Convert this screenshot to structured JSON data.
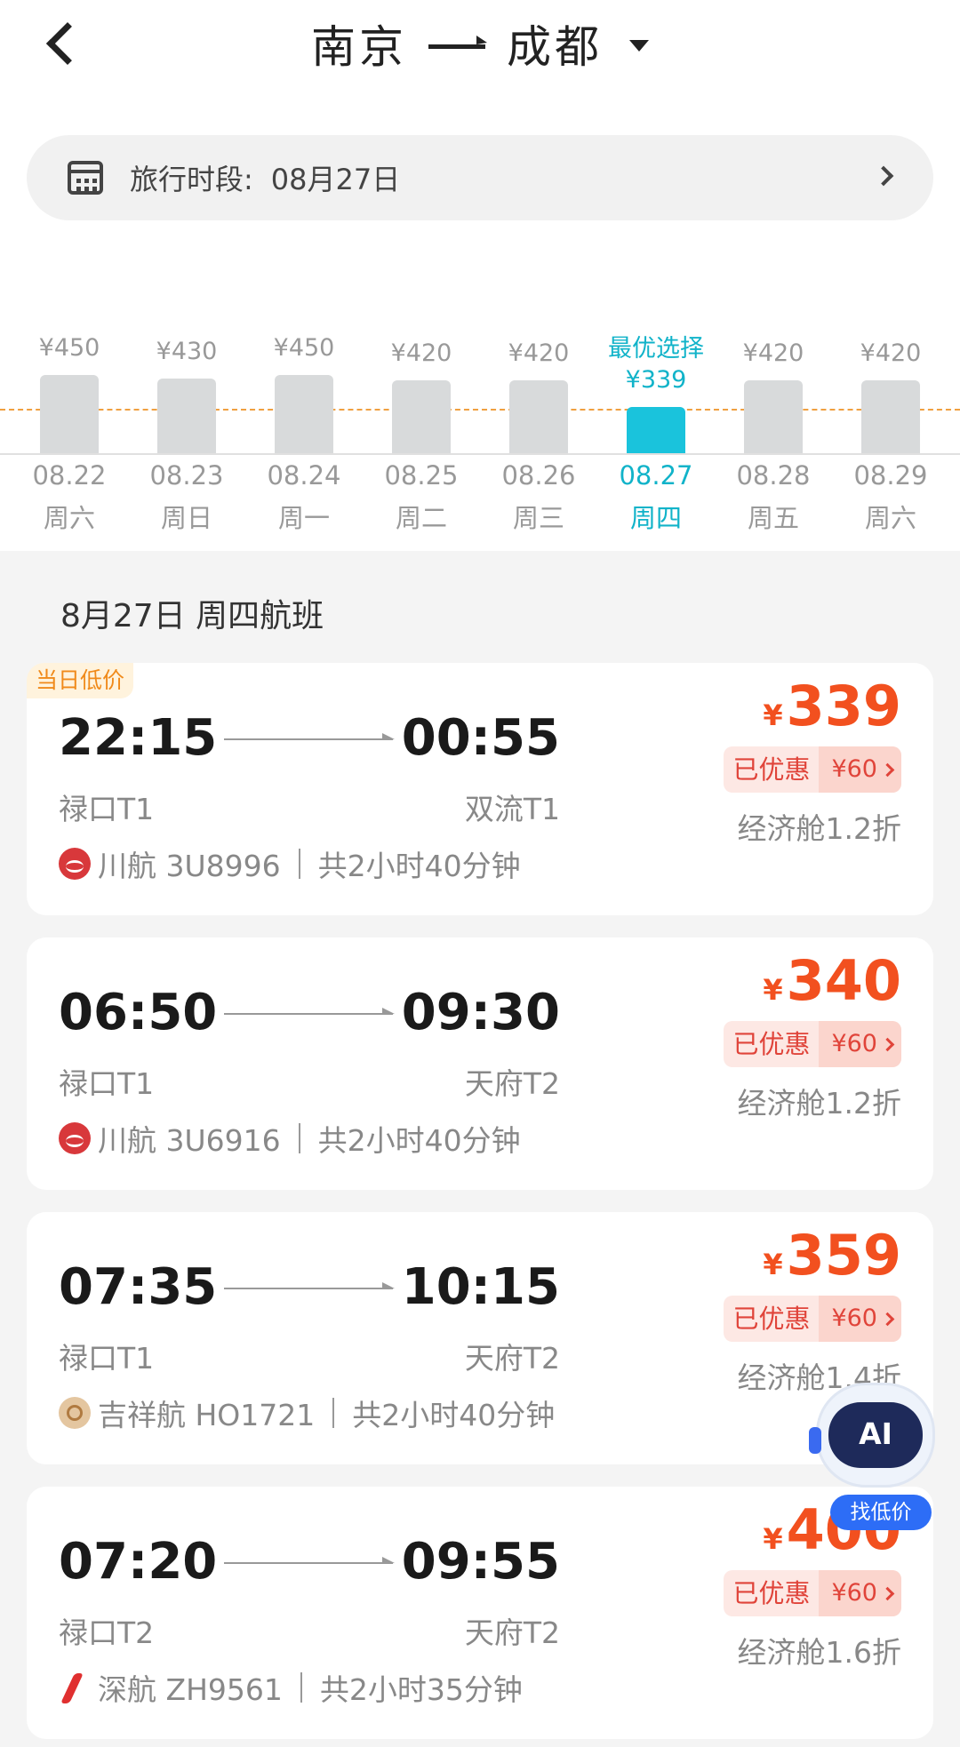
{
  "header": {
    "from_city": "南京",
    "to_city": "成都"
  },
  "date_bar": {
    "label": "旅行时段:",
    "value": "08月27日"
  },
  "calendar": [
    {
      "price": "¥450",
      "date": "08.22",
      "weekday": "周六",
      "active": false
    },
    {
      "price": "¥430",
      "date": "08.23",
      "weekday": "周日",
      "active": false
    },
    {
      "price": "¥450",
      "date": "08.24",
      "weekday": "周一",
      "active": false
    },
    {
      "price": "¥420",
      "date": "08.25",
      "weekday": "周二",
      "active": false
    },
    {
      "price": "¥420",
      "date": "08.26",
      "weekday": "周三",
      "active": false
    },
    {
      "price": "¥339",
      "date": "08.27",
      "weekday": "周四",
      "active": true,
      "best_label": "最优选择"
    },
    {
      "price": "¥420",
      "date": "08.28",
      "weekday": "周五",
      "active": false
    },
    {
      "price": "¥420",
      "date": "08.29",
      "weekday": "周六",
      "active": false
    }
  ],
  "section_title": "8月27日 周四航班",
  "flights": [
    {
      "tag": "当日低价",
      "dep_time": "22:15",
      "arr_time": "00:55",
      "dep_airport": "禄口T1",
      "arr_airport": "双流T1",
      "airline": "川航 3U8996",
      "duration": "共2小时40分钟",
      "logo": "sichuan-airlines-logo",
      "currency": "¥",
      "price": "339",
      "discount_label": "已优惠",
      "discount_amount": "¥60",
      "cabin": "经济舱1.2折"
    },
    {
      "tag": "",
      "dep_time": "06:50",
      "arr_time": "09:30",
      "dep_airport": "禄口T1",
      "arr_airport": "天府T2",
      "airline": "川航 3U6916",
      "duration": "共2小时40分钟",
      "logo": "sichuan-airlines-logo",
      "currency": "¥",
      "price": "340",
      "discount_label": "已优惠",
      "discount_amount": "¥60",
      "cabin": "经济舱1.2折"
    },
    {
      "tag": "",
      "dep_time": "07:35",
      "arr_time": "10:15",
      "dep_airport": "禄口T1",
      "arr_airport": "天府T2",
      "airline": "吉祥航 HO1721",
      "duration": "共2小时40分钟",
      "logo": "juneyao-airlines-logo",
      "currency": "¥",
      "price": "359",
      "discount_label": "已优惠",
      "discount_amount": "¥60",
      "cabin": "经济舱1.4折"
    },
    {
      "tag": "",
      "dep_time": "07:20",
      "arr_time": "09:55",
      "dep_airport": "禄口T2",
      "arr_airport": "天府T2",
      "airline": "深航 ZH9561",
      "duration": "共2小时35分钟",
      "logo": "shenzhen-airlines-logo",
      "currency": "¥",
      "price": "400",
      "discount_label": "已优惠",
      "discount_amount": "¥60",
      "cabin": "经济舱1.6折"
    }
  ],
  "ai_assistant": {
    "badge": "AI",
    "label": "找低价"
  }
}
